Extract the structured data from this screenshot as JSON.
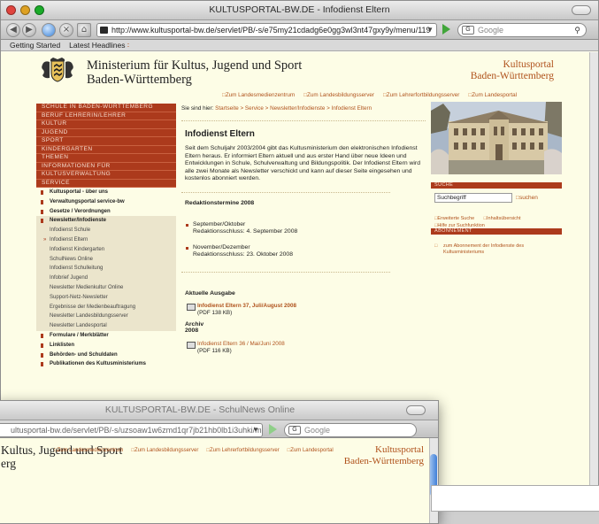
{
  "colors": {
    "accent": "#ac3a1c",
    "link": "#b0521c",
    "page_bg": "#fdfde6"
  },
  "browser": {
    "title": "KULTUSPORTAL-BW.DE - Infodienst Eltern",
    "url": "http://www.kultusportal-bw.de/servlet/PB/-s/e75my21cdadg6e0gg3wl3nt47gxy9y/menu/119",
    "search_placeholder": "Google",
    "bookmarks": [
      "Getting Started",
      "Latest Headlines"
    ]
  },
  "header": {
    "ministry_line1": "Ministerium für Kultus, Jugend und Sport",
    "ministry_line2": "Baden-Württemberg",
    "portal_line1": "Kultusportal",
    "portal_line2": "Baden-Württemberg"
  },
  "toplinks": [
    "Zum Landesmedienzentrum",
    "Zum Landesbildungsserver",
    "Zum Lehrerfortbildungsserver",
    "Zum Landesportal"
  ],
  "nav_main": [
    "SCHULE IN BADEN-WÜRTTEMBERG",
    "BERUF LEHRERIN/LEHRER",
    "KULTUR",
    "JUGEND",
    "SPORT",
    "KINDERGARTEN",
    "THEMEN",
    "INFORMATIONEN FÜR",
    "KULTUSVERWALTUNG",
    "SERVICE"
  ],
  "nav_sub": [
    "Kultusportal - über uns",
    "Verwaltungsportal service-bw",
    "Gesetze / Verordnungen",
    "Newsletter/Infodienste",
    "Infodienst Schule",
    "Infodienst Eltern",
    "Infodienst Kindergarten",
    "SchulNews Online",
    "Infodienst Schulleitung",
    "Infobrief Jugend",
    "Newsletter Medienkultur Online",
    "Support-Netz-Newsletter",
    "Ergebnisse der Medienbeauftragung",
    "Newsletter Landesbildungsserver",
    "Newsletter Landesportal",
    "Formulare / Merkblätter",
    "Linklisten",
    "Behörden- und Schuldaten",
    "Publikationen des Kultusministeriums"
  ],
  "main": {
    "crumb_prefix": "Sie sind hier:",
    "crumbs": "Startseite > Service > Newsletter/Infodienste > Infodienst Eltern",
    "heading": "Infodienst Eltern",
    "intro": "Seit dem Schuljahr 2003/2004 gibt das Kultusministerium den elektronischen Infodienst Eltern heraus. Er informiert Eltern aktuell und aus erster Hand über neue Ideen und Entwicklungen in Schule, Schulverwaltung und Bildungspolitik. Der Infodienst Eltern wird alle zwei Monate als Newsletter verschickt und kann auf dieser Seite eingesehen und kostenlos abonniert werden.",
    "redaktion_title": "Redaktionstermine 2008",
    "termin1_month": "September/Oktober",
    "termin1_date": "Redaktionsschluss: 4. September 2008",
    "termin2_month": "November/Dezember",
    "termin2_date": "Redaktionsschluss: 23. Oktober 2008",
    "aktuelle_title": "Aktuelle Ausgabe",
    "aktuelle_link": "Infodienst Eltern 37, Juli/August 2008",
    "aktuelle_size": "(PDF 138 KB)",
    "archiv_title": "Archiv",
    "archiv_year": "2008",
    "archiv_link": "Infodienst Eltern 36 / Mai/Juni 2008",
    "archiv_size": "(PDF 116 KB)"
  },
  "right": {
    "suche_title": "SUCHE",
    "search_value": "Suchbegriff",
    "search_button": "suchen",
    "erweiterte": "Erweiterte Suche",
    "inhalt": "Inhaltsübersicht",
    "hilfe": "Hilfe zur Suchfunktion",
    "abo_title": "ABONNEMENT",
    "abo_link_1": "zum Abonnement der Infodienste des",
    "abo_link_2": "Kultusministeriums"
  },
  "window2": {
    "title": "KULTUSPORTAL-BW.DE - SchulNews Online",
    "url": "ultusportal-bw.de/servlet/PB/-s/uzsoaw1w6zmd1qr7jb21hb0lb1i3uhki/menu/11",
    "search_placeholder": "Google",
    "ministry_line1": "Kultus, Jugend und Sport",
    "ministry_line2": "erg",
    "portal_line1": "Kultusportal",
    "portal_line2": "Baden-Württemberg"
  }
}
